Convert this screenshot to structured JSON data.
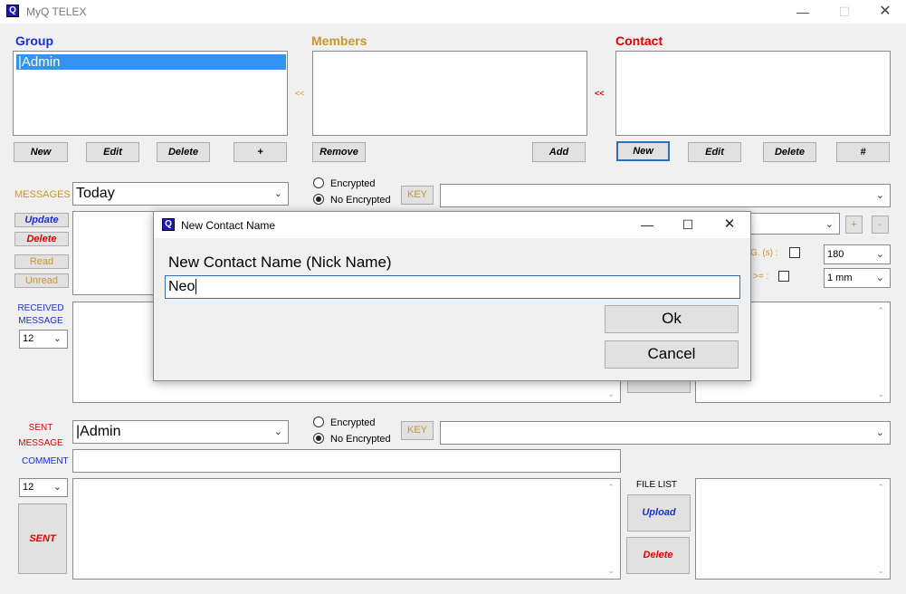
{
  "window": {
    "title": "MyQ TELEX",
    "icon_letter": "Q",
    "min": "—",
    "max": "☐",
    "close": "✕"
  },
  "group": {
    "header": "Group",
    "items": [
      "|Admin"
    ],
    "buttons": {
      "new": "New",
      "edit": "Edit",
      "delete": "Delete",
      "plus": "+"
    }
  },
  "members": {
    "header": "Members",
    "arrow_left": "<<",
    "arrow_right": "<<",
    "buttons": {
      "remove": "Remove",
      "add": "Add"
    }
  },
  "contact": {
    "header": "Contact",
    "buttons": {
      "new": "New",
      "edit": "Edit",
      "delete": "Delete",
      "hash": "#"
    }
  },
  "messages": {
    "label": "MESSAGES",
    "filter_value": "Today",
    "encrypted_label": "Encrypted",
    "no_encrypted_label": "No Encrypted",
    "key_label": "KEY",
    "buttons": {
      "update": "Update",
      "delete": "Delete",
      "read": "Read",
      "unread": "Unread"
    },
    "plus": "+",
    "minus": "-",
    "g_label": "G. (s) :",
    "ge_label": ">= :",
    "interval_value": "180",
    "size_value": "1 mm"
  },
  "received": {
    "label_line1": "RECEIVED",
    "label_line2": "MESSAGE",
    "font_size": "12"
  },
  "sent": {
    "label_line1": "SENT",
    "label_line2": "MESSAGE",
    "recipient": "|Admin",
    "encrypted_label": "Encrypted",
    "no_encrypted_label": "No Encrypted",
    "key_label": "KEY",
    "comment_label": "COMMENT",
    "font_size": "12",
    "send_button": "SENT"
  },
  "files": {
    "label": "FILE LIST",
    "upload": "Upload",
    "delete": "Delete"
  },
  "dialog": {
    "title": "New Contact Name",
    "prompt": "New Contact Name (Nick Name)",
    "value": "Neo",
    "ok": "Ok",
    "cancel": "Cancel",
    "min": "—",
    "max": "☐",
    "close": "✕"
  },
  "colors": {
    "blue_header": "#1c2fd0",
    "gold_header": "#c8962a",
    "red_header": "#e00000"
  }
}
